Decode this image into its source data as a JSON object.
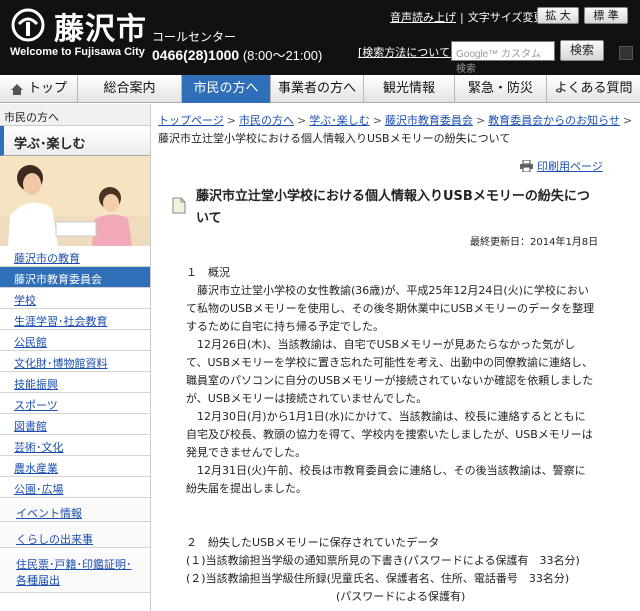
{
  "header": {
    "logo_text": "藤沢市",
    "logo_sub": "Welcome to Fujisawa City",
    "callcenter_label": "コールセンター",
    "callcenter_phone": "0466(28)1000",
    "callcenter_hours": "(8:00～21:00)",
    "read_aloud": "音声読み上げ",
    "font_size_label": "文字サイズ変更",
    "enlarge_button": "拡 大",
    "standard_button": "標 準",
    "search_method": "[検索方法について]",
    "search_placeholder": "Google™ カスタム検索",
    "search_button": "検索"
  },
  "nav": {
    "items": [
      {
        "label": "トップ"
      },
      {
        "label": "総合案内"
      },
      {
        "label": "市民の方へ"
      },
      {
        "label": "事業者の方へ"
      },
      {
        "label": "観光情報"
      },
      {
        "label": "緊急・防災"
      },
      {
        "label": "よくある質問"
      }
    ]
  },
  "sidebar": {
    "crumb": "市民の方へ",
    "heading": "学ぶ･楽しむ",
    "items": [
      {
        "label": "藤沢市の教育"
      },
      {
        "label": "藤沢市教育委員会"
      },
      {
        "label": "学校"
      },
      {
        "label": "生涯学習･社会教育"
      },
      {
        "label": "公民館"
      },
      {
        "label": "文化財･博物館資料"
      },
      {
        "label": "技能振興"
      },
      {
        "label": "スポーツ"
      },
      {
        "label": "図書館"
      },
      {
        "label": "芸術･文化"
      },
      {
        "label": "農水産業"
      },
      {
        "label": "公園･広場"
      },
      {
        "label": "イベント情報"
      },
      {
        "label": "くらしの出来事"
      },
      {
        "label": "住民票･戸籍･印鑑証明･各種届出"
      }
    ]
  },
  "breadcrumb": {
    "links": [
      "トップページ",
      "市民の方へ",
      "学ぶ･楽しむ",
      "藤沢市教育委員会",
      "教育委員会からのお知らせ"
    ],
    "current": "藤沢市立辻堂小学校における個人情報入りUSBメモリーの紛失について"
  },
  "article": {
    "print_label": "印刷用ページ",
    "title": "藤沢市立辻堂小学校における個人情報入りUSBメモリーの紛失について",
    "updated": "最終更新日：2014年1月8日",
    "section1_heading": "１　概況",
    "p1": "　藤沢市立辻堂小学校の女性教諭(36歳)が、平成25年12月24日(火)に学校において私物のUSBメモリーを使用し、その後冬期休業中にUSBメモリーのデータを整理するために自宅に持ち帰る予定でした。",
    "p2": "　12月26日(木)、当該教諭は、自宅でUSBメモリーが見あたらなかった気がして、USBメモリーを学校に置き忘れた可能性を考え、出勤中の同僚教諭に連絡し、職員室のパソコンに自分のUSBメモリーが接続されていないか確認を依頼しましたが、USBメモリーは接続されていませんでした。",
    "p3": "　12月30日(月)から1月1日(水)にかけて、当該教諭は、校長に連絡するとともに自宅及び校長、教頭の協力を得て、学校内を捜索いたしましたが、USBメモリーは発見できませんでした。",
    "p4": "　12月31日(火)午前、校長は市教育委員会に連絡し、その後当該教諭は、警察に紛失届を提出しました。",
    "section2_heading": "２　紛失したUSBメモリーに保存されていたデータ",
    "item1": "(１)当該教諭担当学級の通知票所見の下書き(パスワードによる保護有　33名分)",
    "item2": "(２)当該教諭担当学級住所録(児童氏名、保護者名、住所、電話番号　33名分)",
    "item2_note": "(パスワードによる保護有)"
  }
}
